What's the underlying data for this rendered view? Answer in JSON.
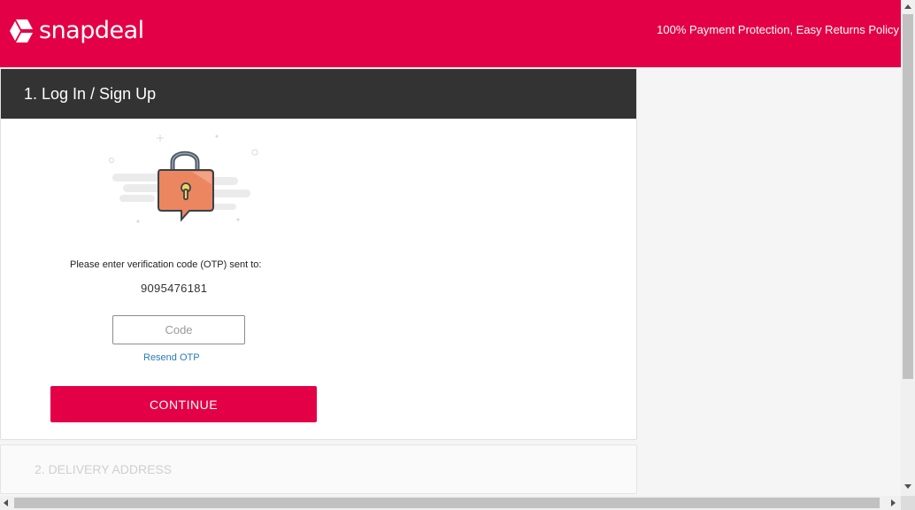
{
  "header": {
    "brand": "snapdeal",
    "tagline": "100% Payment Protection, Easy Returns Policy",
    "logo_icon": "snapdeal-logo-icon",
    "colors": {
      "brand": "#e40046"
    }
  },
  "login": {
    "title": "1. Log In / Sign Up",
    "illustration_icon": "lock-chat-icon",
    "prompt": "Please enter verification code (OTP) sent to:",
    "phone": "9095476181",
    "code_placeholder": "Code",
    "code_value": "",
    "resend_label": "Resend OTP",
    "continue_label": "CONTINUE"
  },
  "delivery": {
    "title": "2. DELIVERY ADDRESS"
  },
  "scrollbars": {
    "vertical_icon_up": "scroll-up-arrow-icon",
    "vertical_icon_down": "scroll-down-arrow-icon",
    "horizontal_icon_left": "scroll-left-arrow-icon",
    "horizontal_icon_right": "scroll-right-arrow-icon"
  }
}
